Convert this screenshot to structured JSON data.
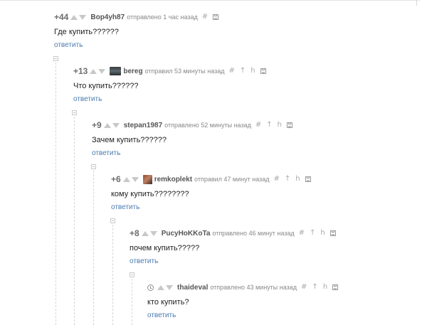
{
  "comments": [
    {
      "rating": "+44",
      "user": "Bop4yh87",
      "meta": "отправлено 1 час назад",
      "text": "Где купить??????",
      "reply": "ответить"
    },
    {
      "rating": "+13",
      "user": "bereg",
      "meta": "отправил 53 минуты назад",
      "text": "Что купить??????",
      "reply": "ответить"
    },
    {
      "rating": "+9",
      "user": "stepan1987",
      "meta": "отправлено 52 минуты назад",
      "text": "Зачем купить??????",
      "reply": "ответить"
    },
    {
      "rating": "+6",
      "user": "remkoplekt",
      "meta": "отправил 47 минут назад",
      "text": "кому купить????????",
      "reply": "ответить"
    },
    {
      "rating": "+8",
      "user": "PucyHoKKoTa",
      "meta": "отправлено 46 минут назад",
      "text": "почем купить?????",
      "reply": "ответить"
    },
    {
      "rating": "",
      "user": "thaideval",
      "meta": "отправлено 43 минуты назад",
      "text": "кто купить?",
      "reply": "ответить"
    }
  ],
  "icons": {
    "anchor": "#",
    "up": "↑",
    "parent": "h"
  }
}
